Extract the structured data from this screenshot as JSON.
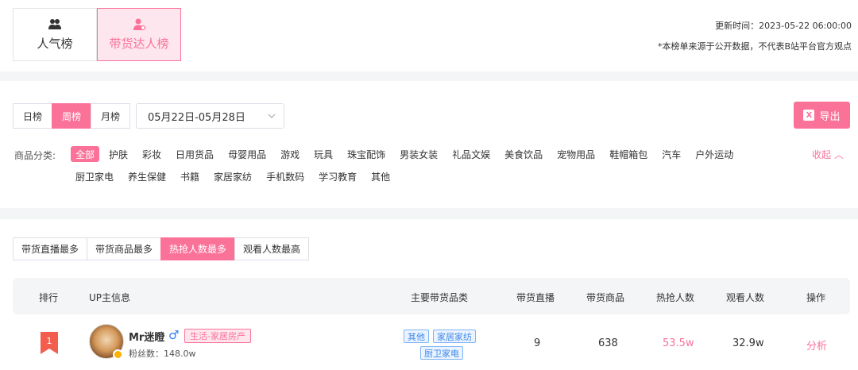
{
  "header": {
    "tabs": [
      {
        "label": "人气榜",
        "icon": "users-icon",
        "active": false
      },
      {
        "label": "带货达人榜",
        "icon": "user-badge-icon",
        "active": true
      }
    ],
    "update_time": "更新时间：2023-05-22 06:00:00",
    "disclaimer": "*本榜单来源于公开数据，不代表B站平台官方观点"
  },
  "filters": {
    "periods": [
      {
        "label": "日榜",
        "active": false
      },
      {
        "label": "周榜",
        "active": true
      },
      {
        "label": "月榜",
        "active": false
      }
    ],
    "date_range": "05月22日-05月28日",
    "export_label": "导出",
    "category_label": "商品分类:",
    "categories_row1": [
      "全部",
      "护肤",
      "彩妆",
      "日用货品",
      "母婴用品",
      "游戏",
      "玩具",
      "珠宝配饰",
      "男装女装",
      "礼品文娱",
      "美食饮品",
      "宠物用品",
      "鞋帽箱包",
      "汽车",
      "户外运动"
    ],
    "categories_row2": [
      "厨卫家电",
      "养生保健",
      "书籍",
      "家居家纺",
      "手机数码",
      "学习教育",
      "其他"
    ],
    "active_category": "全部",
    "collapse_label": "收起"
  },
  "sort_tabs": [
    {
      "label": "带货直播最多",
      "active": false
    },
    {
      "label": "带货商品最多",
      "active": false
    },
    {
      "label": "热抢人数最多",
      "active": true
    },
    {
      "label": "观看人数最高",
      "active": false
    }
  ],
  "table": {
    "columns": [
      "排行",
      "UP主信息",
      "主要带货品类",
      "带货直播",
      "带货商品",
      "热抢人数",
      "观看人数",
      "操作"
    ],
    "rows": [
      {
        "rank": "1",
        "name": "Mr迷瞪",
        "gender": "♂",
        "category_tag": "生活-家居房产",
        "fans": "粉丝数：148.0w",
        "goods_tags": [
          "其他",
          "家居家纺",
          "厨卫家电"
        ],
        "live_count": "9",
        "goods_count": "638",
        "hot_count": "53.5w",
        "view_count": "32.9w",
        "action": "分析"
      }
    ]
  },
  "colors": {
    "accent": "#fb7299",
    "accent_light": "#fde6ee",
    "tag_blue": "#3f8ae8",
    "gender_blue": "#2f7ef6"
  }
}
